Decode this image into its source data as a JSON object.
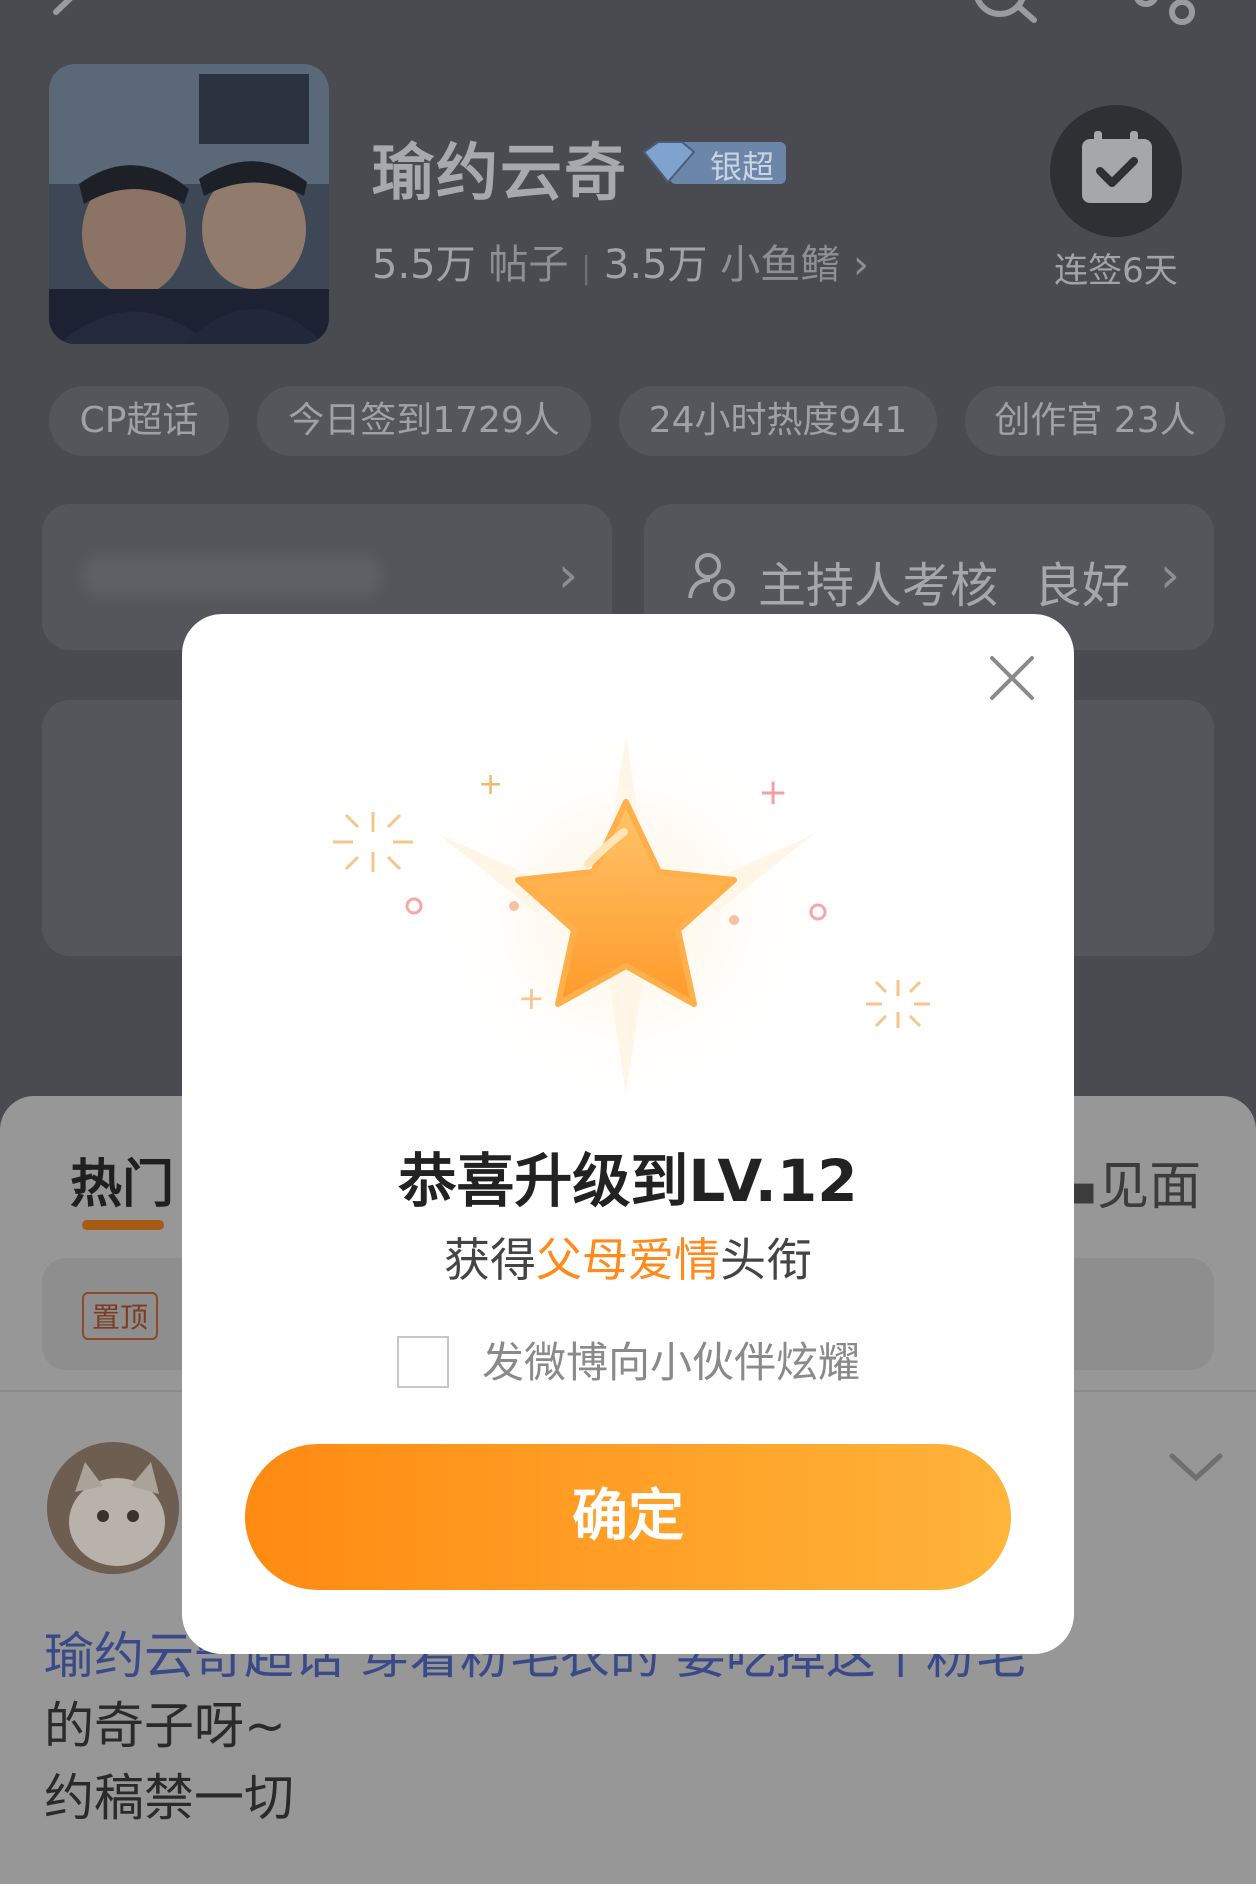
{
  "header": {
    "title": "瑜约云奇",
    "level_badge": "银超",
    "posts_count": "5.5万",
    "posts_label": "帖子",
    "fans_count": "3.5万",
    "fans_label": "小鱼鳍",
    "checkin_label": "连签6天"
  },
  "chips": [
    "CP超话",
    "今日签到1729人",
    "24小时热度941",
    "创作官 23人"
  ],
  "host_card": {
    "label": "主持人考核",
    "value": "良好"
  },
  "tabs": {
    "hot": "热门",
    "meet": "见面"
  },
  "pinned": {
    "badge": "置顶"
  },
  "post": {
    "line1": "瑜约云奇超话  穿着粉毛衣的  要吃掉这个粉毛",
    "line2": "的奇子呀~",
    "line3": "约稿禁一切"
  },
  "dialog": {
    "title": "恭喜升级到LV.12",
    "subtitle_prefix": "获得",
    "subtitle_highlight": "父母爱情",
    "subtitle_suffix": "头衔",
    "share_label": "发微博向小伙伴炫耀",
    "confirm_label": "确定"
  },
  "colors": {
    "accent": "#ff9a1f",
    "overlay": "#4a4b50"
  }
}
